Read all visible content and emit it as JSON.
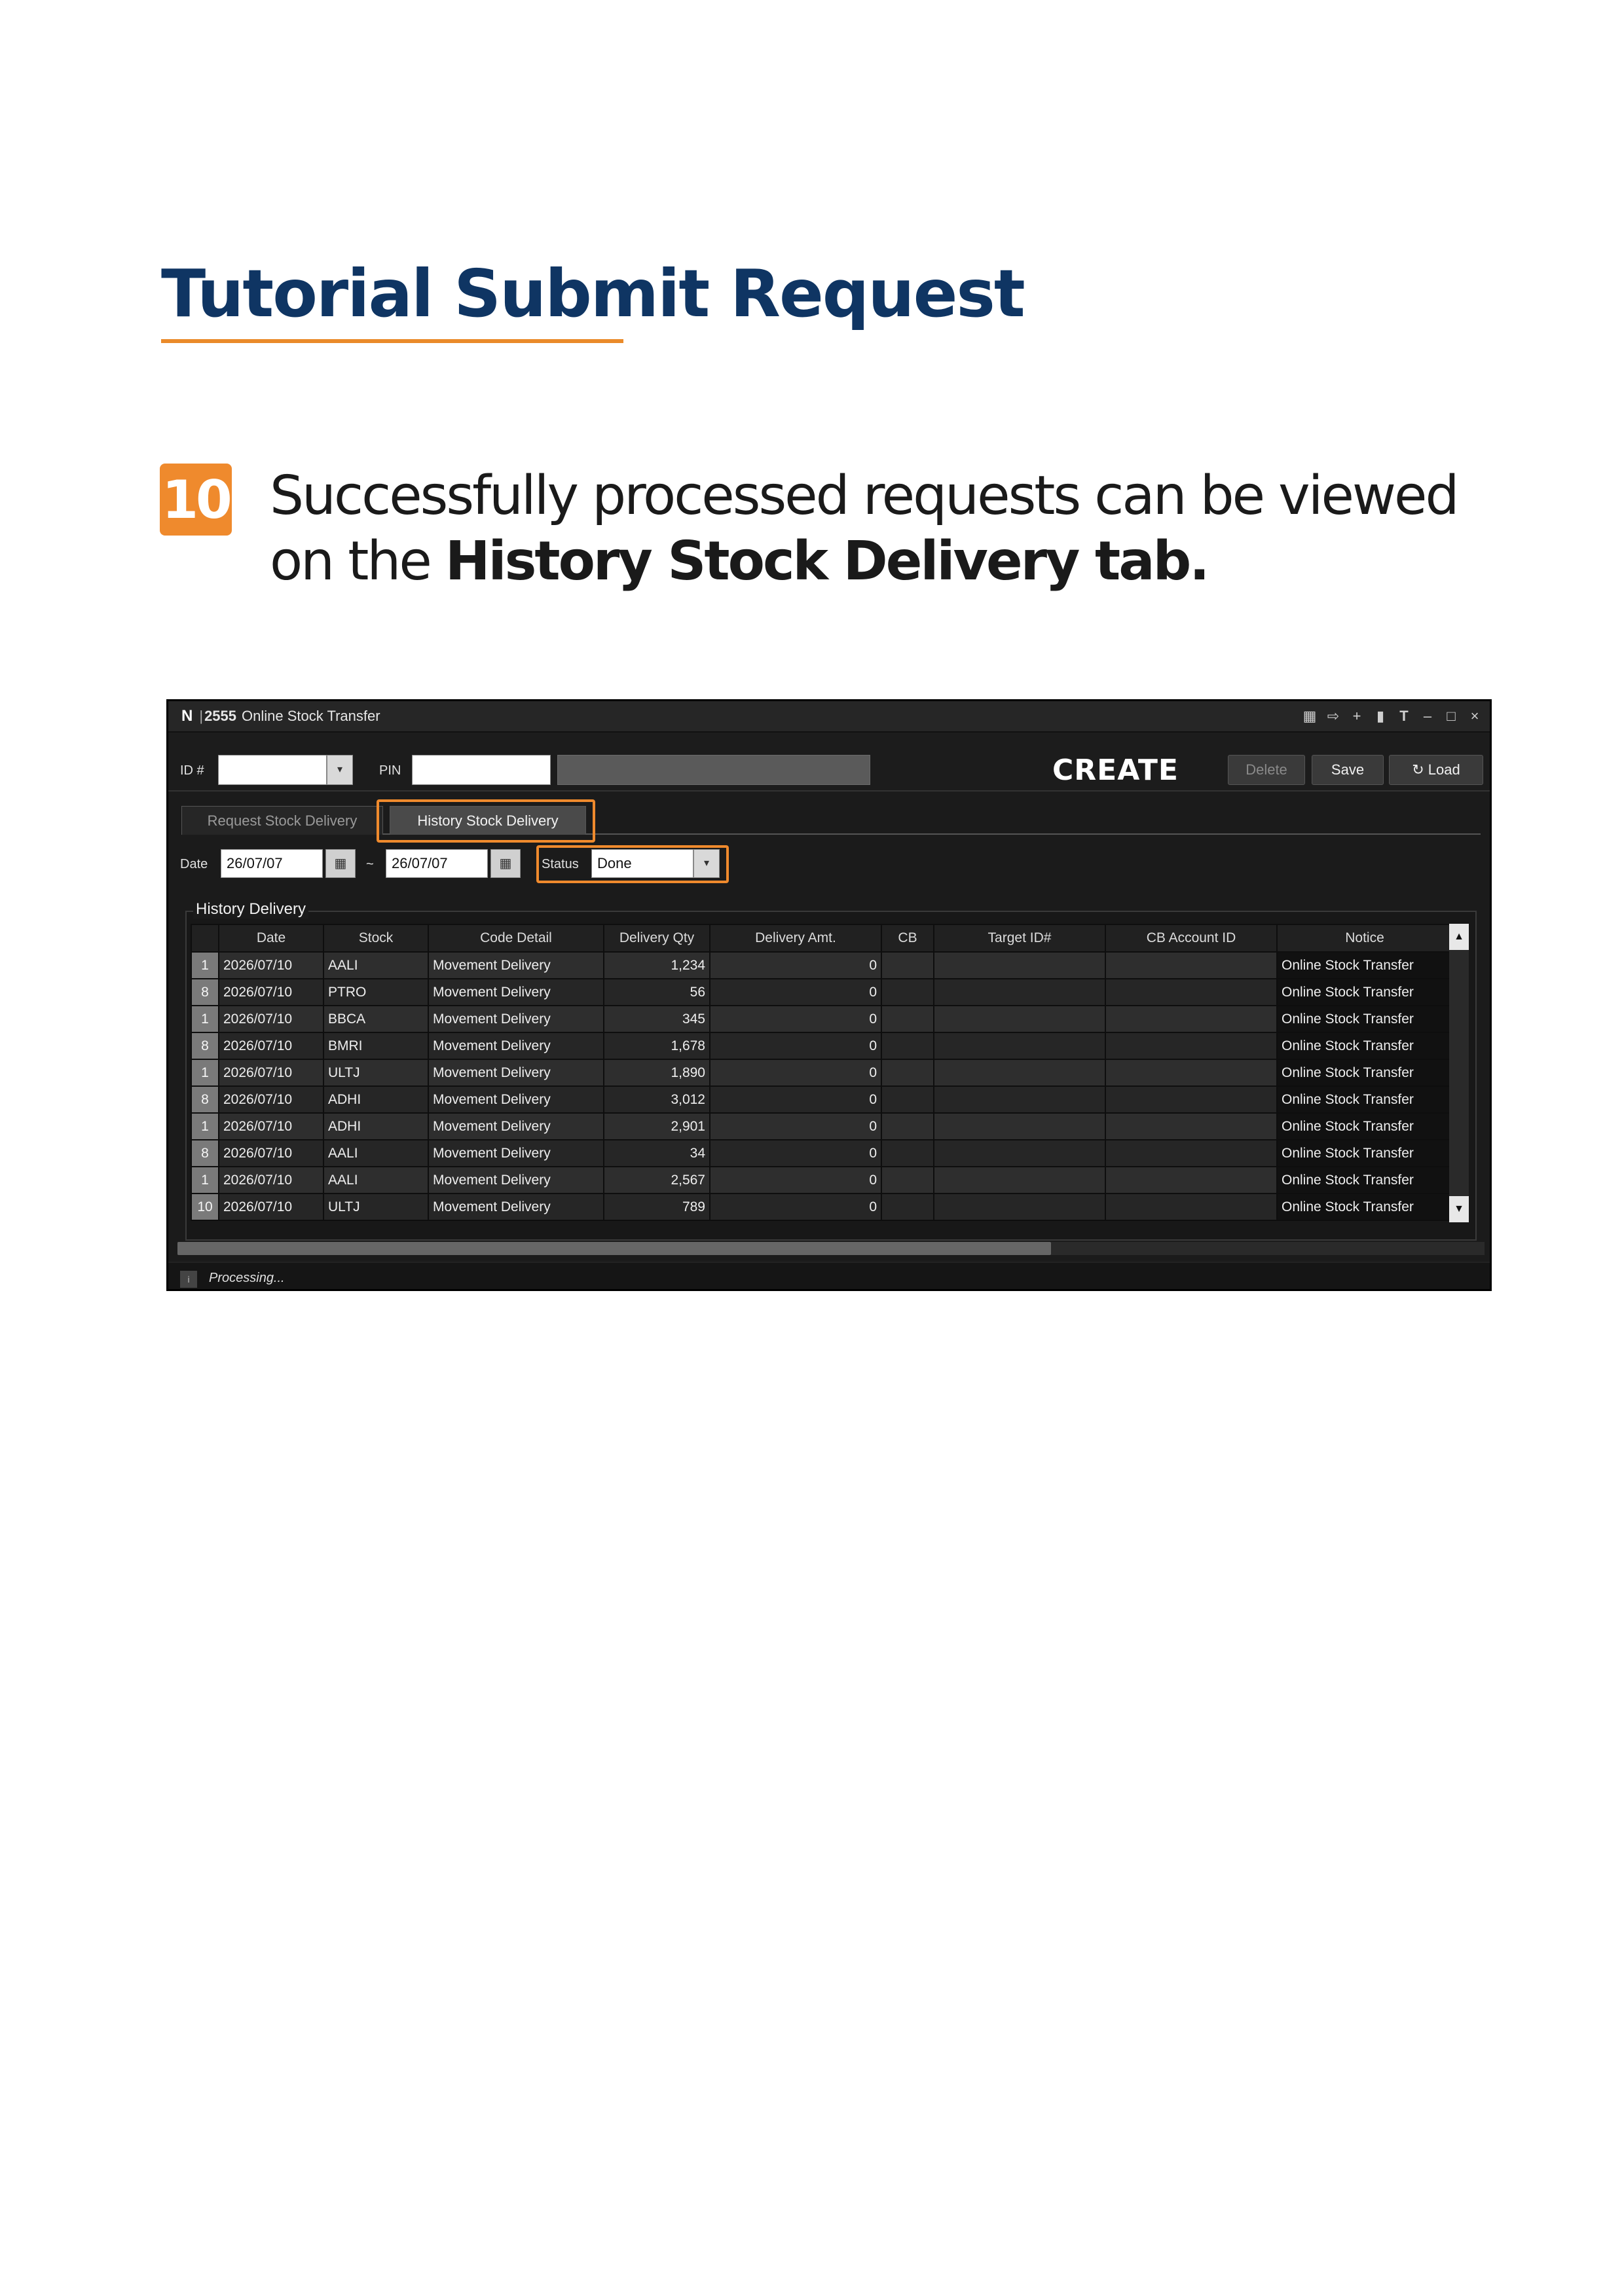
{
  "doc": {
    "title": "Tutorial Submit Request",
    "step_number": "10",
    "step_text_1": "Successfully processed requests can be viewed on the ",
    "step_text_bold": "History Stock Delivery tab."
  },
  "window": {
    "logo": "N",
    "separator": "|",
    "code": "2555",
    "title": "Online Stock Transfer",
    "controls": [
      "grid-icon",
      "exit-icon",
      "plus-icon",
      "trash-icon",
      "font-size-icon",
      "minimize-icon",
      "maximize-icon",
      "close-icon"
    ]
  },
  "toolbar": {
    "id_label": "ID #",
    "id_value": "",
    "pin_label": "PIN",
    "pin_value": "",
    "create_label": "CREATE",
    "delete_label": "Delete",
    "save_label": "Save",
    "load_label": "Load"
  },
  "tabs": [
    {
      "label": "Request Stock Delivery",
      "active": false
    },
    {
      "label": "History Stock Delivery",
      "active": true
    }
  ],
  "filters": {
    "date_label": "Date",
    "date_from": "26/07/07",
    "range_sep": "~",
    "date_to": "26/07/07",
    "status_label": "Status",
    "status_value": "Done"
  },
  "grid": {
    "caption": "History Delivery",
    "columns": [
      "",
      "Date",
      "Stock",
      "Code Detail",
      "Delivery Qty",
      "Delivery Amt.",
      "CB",
      "Target ID#",
      "CB Account ID",
      "Notice"
    ],
    "rows": [
      {
        "idx": "1",
        "date": "2026/07/10",
        "stock": "AALI",
        "code": "Movement Delivery",
        "qty": "1,234",
        "amt": "0",
        "cb": "",
        "target": "",
        "cbacc": "",
        "notice": "Online Stock Transfer"
      },
      {
        "idx": "8",
        "date": "2026/07/10",
        "stock": "PTRO",
        "code": "Movement Delivery",
        "qty": "56",
        "amt": "0",
        "cb": "",
        "target": "",
        "cbacc": "",
        "notice": "Online Stock Transfer"
      },
      {
        "idx": "1",
        "date": "2026/07/10",
        "stock": "BBCA",
        "code": "Movement Delivery",
        "qty": "345",
        "amt": "0",
        "cb": "",
        "target": "",
        "cbacc": "",
        "notice": "Online Stock Transfer"
      },
      {
        "idx": "8",
        "date": "2026/07/10",
        "stock": "BMRI",
        "code": "Movement Delivery",
        "qty": "1,678",
        "amt": "0",
        "cb": "",
        "target": "",
        "cbacc": "",
        "notice": "Online Stock Transfer"
      },
      {
        "idx": "1",
        "date": "2026/07/10",
        "stock": "ULTJ",
        "code": "Movement Delivery",
        "qty": "1,890",
        "amt": "0",
        "cb": "",
        "target": "",
        "cbacc": "",
        "notice": "Online Stock Transfer"
      },
      {
        "idx": "8",
        "date": "2026/07/10",
        "stock": "ADHI",
        "code": "Movement Delivery",
        "qty": "3,012",
        "amt": "0",
        "cb": "",
        "target": "",
        "cbacc": "",
        "notice": "Online Stock Transfer"
      },
      {
        "idx": "1",
        "date": "2026/07/10",
        "stock": "ADHI",
        "code": "Movement Delivery",
        "qty": "2,901",
        "amt": "0",
        "cb": "",
        "target": "",
        "cbacc": "",
        "notice": "Online Stock Transfer"
      },
      {
        "idx": "8",
        "date": "2026/07/10",
        "stock": "AALI",
        "code": "Movement Delivery",
        "qty": "34",
        "amt": "0",
        "cb": "",
        "target": "",
        "cbacc": "",
        "notice": "Online Stock Transfer"
      },
      {
        "idx": "1",
        "date": "2026/07/10",
        "stock": "AALI",
        "code": "Movement Delivery",
        "qty": "2,567",
        "amt": "0",
        "cb": "",
        "target": "",
        "cbacc": "",
        "notice": "Online Stock Transfer"
      },
      {
        "idx": "10",
        "date": "2026/07/10",
        "stock": "ULTJ",
        "code": "Movement Delivery",
        "qty": "789",
        "amt": "0",
        "cb": "",
        "target": "",
        "cbacc": "",
        "notice": "Online Stock Transfer"
      }
    ]
  },
  "status_bar": {
    "icon": "info-icon",
    "text": "Processing..."
  },
  "colors": {
    "title_blue": "#0f3563",
    "accent_orange": "#ef8a2d"
  }
}
